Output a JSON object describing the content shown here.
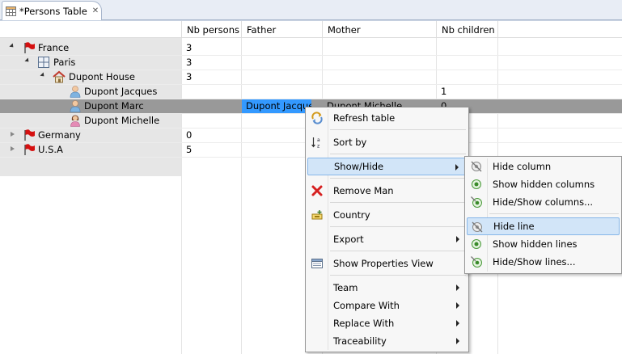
{
  "tab": {
    "title": "*Persons Table",
    "close": "✕"
  },
  "columns": [
    "",
    "Nb persons",
    "Father",
    "Mother",
    "Nb children"
  ],
  "rows": [
    {
      "name": "France",
      "nb_persons": "3",
      "father": "",
      "mother": "",
      "nb_children": ""
    },
    {
      "name": "Paris",
      "nb_persons": "3",
      "father": "",
      "mother": "",
      "nb_children": ""
    },
    {
      "name": "Dupont House",
      "nb_persons": "3",
      "father": "",
      "mother": "",
      "nb_children": ""
    },
    {
      "name": "Dupont Jacques",
      "nb_persons": "",
      "father": "",
      "mother": "",
      "nb_children": "1"
    },
    {
      "name": "Dupont Marc",
      "nb_persons": "",
      "father": "Dupont Jacques",
      "mother": "Dupont Michelle",
      "nb_children": "0"
    },
    {
      "name": "Dupont Michelle",
      "nb_persons": "",
      "father": "",
      "mother": "",
      "nb_children": ""
    },
    {
      "name": "Germany",
      "nb_persons": "0",
      "father": "",
      "mother": "",
      "nb_children": ""
    },
    {
      "name": "U.S.A",
      "nb_persons": "5",
      "father": "",
      "mother": "",
      "nb_children": ""
    }
  ],
  "context_menu": {
    "refresh": "Refresh table",
    "sort": "Sort by",
    "show_hide": "Show/Hide",
    "remove": "Remove Man",
    "country": "Country",
    "export": "Export",
    "properties": "Show Properties View",
    "team": "Team",
    "compare": "Compare With",
    "replace": "Replace With",
    "traceability": "Traceability"
  },
  "submenu": {
    "hide_column": "Hide column",
    "show_hidden_columns": "Show hidden columns",
    "hide_show_columns": "Hide/Show columns...",
    "hide_line": "Hide line",
    "show_hidden_lines": "Show hidden lines",
    "hide_show_lines": "Hide/Show lines..."
  },
  "colors": {
    "selection": "#3399ff",
    "selected_row": "#999999",
    "menu_highlight": "#d2e5f8",
    "tree_bg": "#e6e6e6"
  }
}
